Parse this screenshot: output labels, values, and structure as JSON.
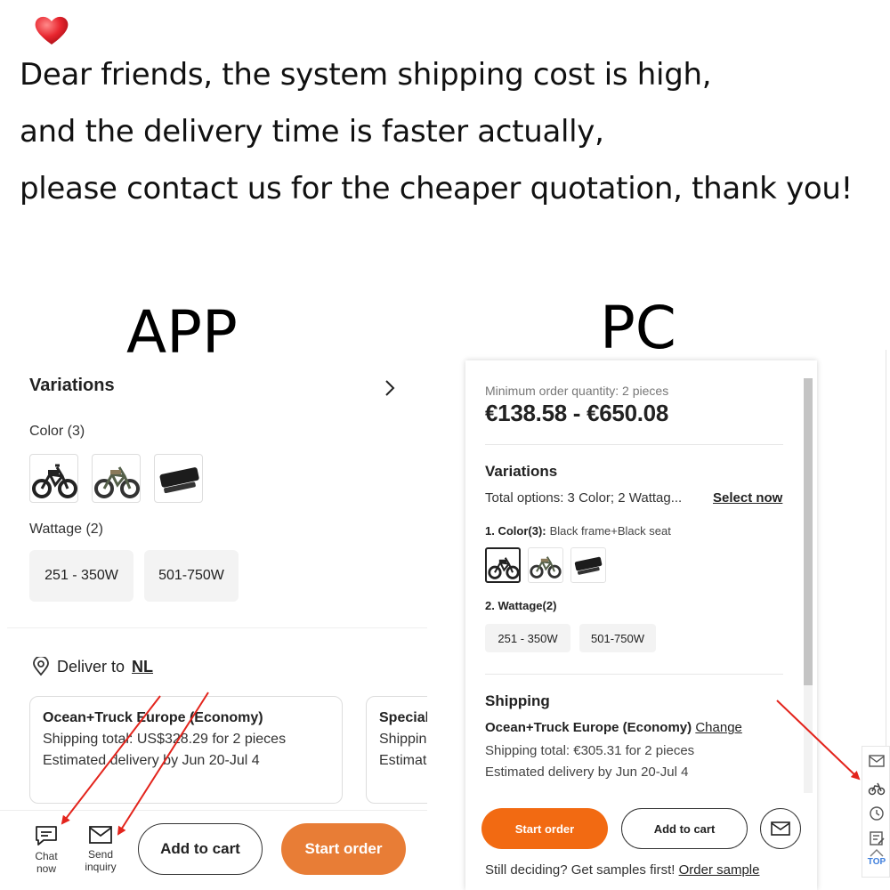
{
  "notice": {
    "line1": "Dear friends, the system shipping cost is high,",
    "line2": "and the delivery time is faster actually,",
    "line3": "please contact us for the cheaper quotation, thank you!",
    "heart_color": "#e8262f"
  },
  "labels": {
    "app": "APP",
    "pc": "PC"
  },
  "app": {
    "variations_title": "Variations",
    "color_label": "Color (3)",
    "wattage_label": "Wattage (2)",
    "wattage_options": [
      "251 - 350W",
      "501-750W"
    ],
    "deliver_prefix": "Deliver to",
    "deliver_country": "NL",
    "cards": [
      {
        "title": "Ocean+Truck Europe (Economy)",
        "shipping": "Shipping total: US$328.29 for 2 pieces",
        "delivery": "Estimated delivery by Jun 20-Jul 4"
      },
      {
        "title": "Special",
        "shipping": "Shippin",
        "delivery": "Estimat"
      }
    ],
    "chat_label_1": "Chat",
    "chat_label_2": "now",
    "inquiry_label_1": "Send",
    "inquiry_label_2": "inquiry",
    "add_to_cart": "Add to cart",
    "start_order": "Start order",
    "accent_color": "#e87d36"
  },
  "pc": {
    "moq": "Minimum order quantity: 2 pieces",
    "price": "€138.58 - €650.08",
    "variations_title": "Variations",
    "total_options": "Total options: 3 Color; 2 Wattag...",
    "select_now": "Select now",
    "color_label": "1. Color(3):",
    "color_value": "Black frame+Black seat",
    "wattage_label": "2. Wattage(2)",
    "wattage_options": [
      "251 - 350W",
      "501-750W"
    ],
    "shipping_title": "Shipping",
    "shipping_method": "Ocean+Truck Europe (Economy)",
    "change": "Change",
    "shipping_total": "Shipping total: €305.31 for 2 pieces",
    "delivery": "Estimated delivery by Jun 20-Jul 4",
    "start_order": "Start order",
    "add_to_cart": "Add to cart",
    "samples_text": "Still deciding? Get samples first!",
    "order_sample": "Order sample",
    "top_label": "TOP",
    "accent_color": "#f26a12"
  },
  "arrow_color": "#e3241c"
}
